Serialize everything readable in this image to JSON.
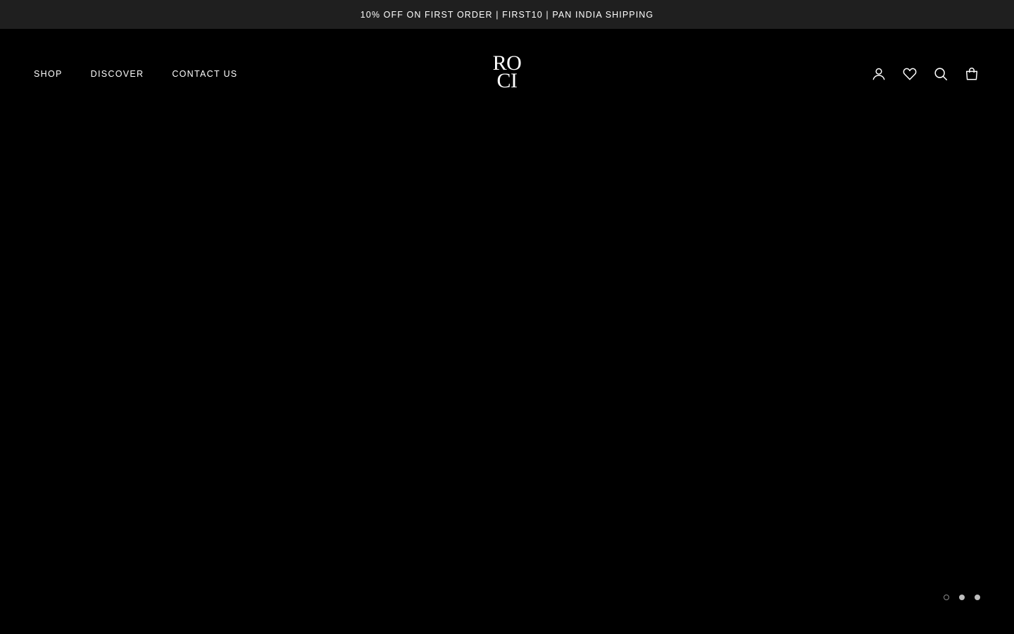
{
  "announcement": {
    "text": "10% OFF ON FIRST ORDER | FIRST10 | PAN INDIA SHIPPING"
  },
  "nav": {
    "items": [
      {
        "label": "SHOP"
      },
      {
        "label": "DISCOVER"
      },
      {
        "label": "CONTACT US"
      }
    ]
  },
  "logo": {
    "line1": "RO",
    "line2": "CI"
  },
  "header_icons": [
    "account-icon",
    "wishlist-heart-icon",
    "search-icon",
    "cart-bag-icon"
  ],
  "slideshow": {
    "slide_count": 3,
    "active_index": 0
  },
  "colors": {
    "announcement_bg": "#1f1f1f",
    "page_bg": "#000000",
    "text": "#ffffff"
  }
}
